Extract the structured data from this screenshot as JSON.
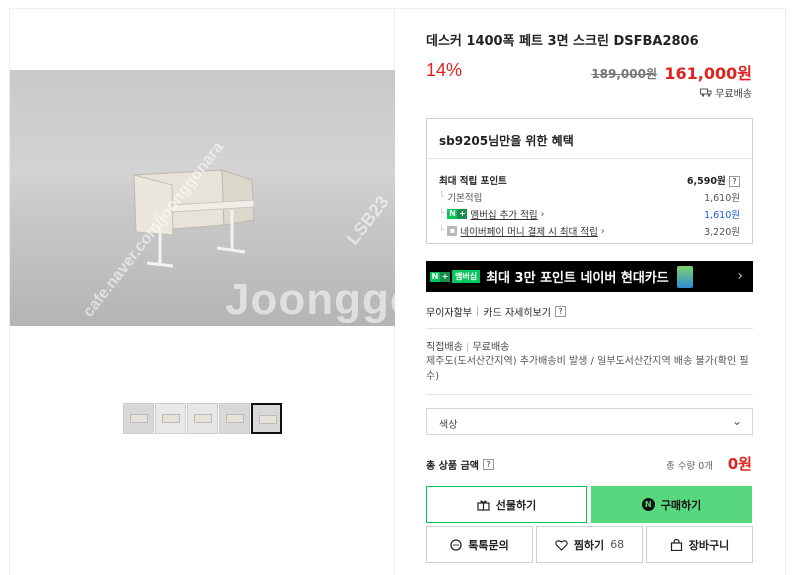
{
  "product": {
    "title": "데스커 1400폭 페트 3면 스크린 DSFBA2806",
    "discount_rate": "14%",
    "original_price": "189,000원",
    "sale_price": "161,000원",
    "shipping_badge": "무료배송"
  },
  "gallery": {
    "watermark_brand": "Joonggonara",
    "watermark_url": "cafe.naver.com/joonggonara",
    "watermark_code": "LSB23",
    "thumbnail_count": 5,
    "selected_thumbnail": 5
  },
  "benefits": {
    "header": "sb9205님만을 위한 혜택",
    "max_points_label": "최대 적립 포인트",
    "max_points_value": "6,590원",
    "basic_label": "기본적립",
    "basic_value": "1,610원",
    "membership_label": "멤버십 추가 적립",
    "membership_value": "1,610원",
    "naverpay_label": "네이버페이 머니 결제 시 최대 적립",
    "naverpay_value": "3,220원"
  },
  "banner": {
    "tag": "멤버십",
    "text": "최대 3만 포인트 네이버 현대카드"
  },
  "payment_links": {
    "installment": "무이자할부",
    "card_benefits": "카드 자세히보기"
  },
  "shipping": {
    "type": "직접배송",
    "fee": "무료배송",
    "note": "제주도(도서산간지역) 추가배송비 발생 / 일부도서산간지역 배송 불가(확인 필수)"
  },
  "option": {
    "placeholder": "색상"
  },
  "total": {
    "label": "총 상품 금액",
    "quantity": "총 수량 0개",
    "amount": "0원"
  },
  "buttons": {
    "gift": "선물하기",
    "buy": "구매하기",
    "talk": "톡톡문의",
    "zzim": "찜하기",
    "zzim_count": "68",
    "cart": "장바구니"
  },
  "colors": {
    "accent_red": "#e0231e",
    "naver_green": "#03c75a",
    "buy_green": "#57d77e",
    "link_blue": "#1b5fcf"
  }
}
